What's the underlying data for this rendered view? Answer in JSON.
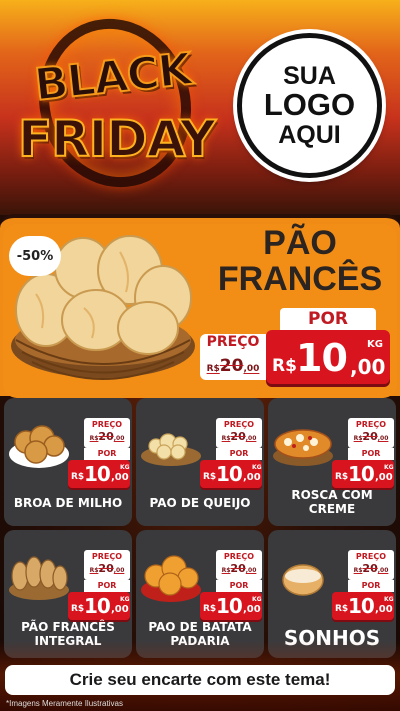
{
  "header": {
    "black_text": "BLACK",
    "friday_text": "FRIDAY",
    "logo": {
      "line1": "SUA",
      "line2": "LOGO",
      "line3": "AQUI"
    }
  },
  "featured": {
    "discount": "-50%",
    "title_line1": "PÃO",
    "title_line2": "FRANCÊS",
    "preco_label": "PREÇO",
    "old_price_currency": "R$",
    "old_price_value": "20",
    "old_price_cents": ",00",
    "por_label": "POR",
    "new_price_currency": "R$",
    "new_price_value": "10",
    "new_price_cents": ",00",
    "unit": "KG"
  },
  "products": [
    {
      "name": "BROA DE MILHO",
      "preco_label": "PREÇO",
      "old_cur": "R$",
      "old_val": "20",
      "old_cents": ",00",
      "por_label": "POR",
      "cur": "R$",
      "val": "10",
      "cents": ",00",
      "unit": "KG"
    },
    {
      "name": "PAO DE QUEIJO",
      "preco_label": "PREÇO",
      "old_cur": "R$",
      "old_val": "20",
      "old_cents": ",00",
      "por_label": "POR",
      "cur": "R$",
      "val": "10",
      "cents": ",00",
      "unit": "KG"
    },
    {
      "name": "ROSCA COM CREME",
      "preco_label": "PREÇO",
      "old_cur": "R$",
      "old_val": "20",
      "old_cents": ",00",
      "por_label": "POR",
      "cur": "R$",
      "val": "10",
      "cents": ",00",
      "unit": "KG"
    },
    {
      "name": "PÃO FRANCÊS INTEGRAL",
      "preco_label": "PREÇO",
      "old_cur": "R$",
      "old_val": "20",
      "old_cents": ",00",
      "por_label": "POR",
      "cur": "R$",
      "val": "10",
      "cents": ",00",
      "unit": "KG"
    },
    {
      "name": "PAO DE BATATA PADARIA",
      "preco_label": "PREÇO",
      "old_cur": "R$",
      "old_val": "20",
      "old_cents": ",00",
      "por_label": "POR",
      "cur": "R$",
      "val": "10",
      "cents": ",00",
      "unit": "KG"
    },
    {
      "name": "SONHOS",
      "preco_label": "PREÇO",
      "old_cur": "R$",
      "old_val": "20",
      "old_cents": ",00",
      "por_label": "POR",
      "cur": "R$",
      "val": "10",
      "cents": ",00",
      "unit": "KG"
    }
  ],
  "footer": {
    "cta": "Crie seu encarte com este tema!",
    "disclaimer": "*Imagens Meramente Ilustrativas"
  },
  "colors": {
    "accent_red": "#d8151e",
    "orange": "#f28e16",
    "card_bg": "#3a3a3d"
  }
}
